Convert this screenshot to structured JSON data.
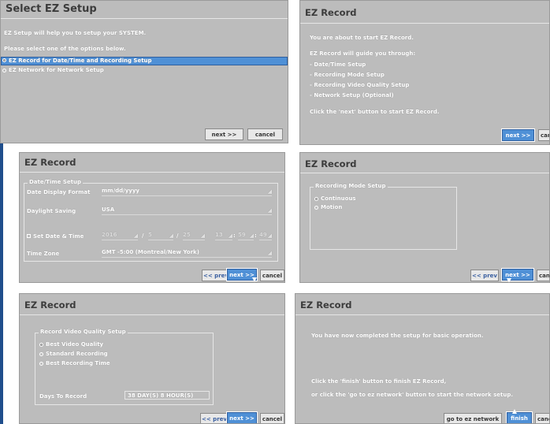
{
  "panel1": {
    "title": "Select  EZ  Setup",
    "line1": "EZ Setup will help you to setup your SYSTEM.",
    "line2": "Please select one of the options below.",
    "option1": "EZ Record for Date/Time and Recording Setup",
    "option2": "EZ Network for Network Setup",
    "next": "next >>",
    "cancel": "cancel"
  },
  "panel2": {
    "title": "EZ  Record",
    "line1": "You are about to start EZ Record.",
    "line2": "EZ Record will guide you through:",
    "items": [
      "- Date/Time Setup",
      "- Recording Mode Setup",
      "- Recording Video Quality Setup",
      "- Network Setup (Optional)"
    ],
    "line3": "Click the 'next' button to start EZ Record.",
    "next": "next >>",
    "cancel": "canc"
  },
  "panel3": {
    "title": "EZ  Record",
    "group": "Date/Time Setup",
    "date_format_label": "Date Display Format",
    "date_format_value": "mm/dd/yyyy",
    "daylight_label": "Daylight Saving",
    "daylight_value": "USA",
    "set_date_label": "Set Date & Time",
    "year": "2016",
    "month": "5",
    "day": "25",
    "hour": "13",
    "minute": "59",
    "second": "49",
    "sep_slash": "/",
    "sep_colon": ":",
    "timezone_label": "Time Zone",
    "timezone_value": "GMT -5:00 (Montreal/New York)",
    "prev": "<< prev",
    "next": "next >>",
    "cancel": "cancel"
  },
  "panel4": {
    "title": "EZ  Record",
    "group": "Recording Mode Setup",
    "option1": "Continuous",
    "option2": "Motion",
    "prev": "<< prev",
    "next": "next >>",
    "cancel": "canc"
  },
  "panel5": {
    "title": "EZ  Record",
    "group": "Record Video Quality Setup",
    "option1": "Best Video Quality",
    "option2": "Standard Recording",
    "option3": "Best Recording Time",
    "days_label": "Days To Record",
    "days_value": "38 DAY(S) 8 HOUR(S)",
    "prev": "<< prev",
    "next": "next >>",
    "cancel": "cancel"
  },
  "panel6": {
    "title": "EZ  Record",
    "line1": "You have now completed the setup for basic operation.",
    "line2": "Click the 'finish' button to finish EZ Record,",
    "line3": "or click the 'go to ez network' button to start the network setup.",
    "go_network": "go to ez network",
    "finish": "finish",
    "cancel": "canc"
  }
}
